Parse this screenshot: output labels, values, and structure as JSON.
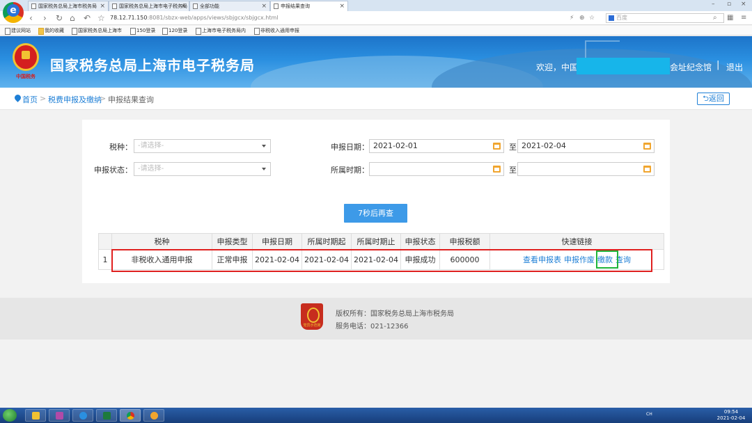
{
  "browser": {
    "tabs": [
      {
        "title": "国家税务总局上海市税务局"
      },
      {
        "title": "国家税务总局上海市电子税务局"
      },
      {
        "title": "全部功能"
      },
      {
        "title": "申报结果查询"
      }
    ],
    "url_host": "78.12.71.150",
    "url_path": ":8081/sbzx-web/apps/views/sbjgcx/sbjgcx.html",
    "search_placeholder": "百度",
    "bookmarks": [
      {
        "label": "建议网站"
      },
      {
        "label": "我的收藏"
      },
      {
        "label": "国家税务总局上海市"
      },
      {
        "label": "150登录"
      },
      {
        "label": "120登录"
      },
      {
        "label": "上海市电子税务局内"
      },
      {
        "label": "非税收入通用申报"
      }
    ]
  },
  "header": {
    "emblem_text": "中国税务",
    "site_title": "国家税务总局上海市电子税务局",
    "welcome": "欢迎，中国",
    "memorial": "会址纪念馆",
    "separator": "|",
    "logout": "退出"
  },
  "breadcrumb": {
    "home": "首页",
    "level1": "税费申报及缴纳",
    "current": "申报结果查询",
    "arrow": ">",
    "back": "返回"
  },
  "form": {
    "tax_type_label": "税种：",
    "tax_type_placeholder": "-请选择-",
    "status_label": "申报状态：",
    "status_placeholder": "-请选择-",
    "date_label": "申报日期：",
    "date_from": "2021-02-01",
    "date_to": "2021-02-04",
    "period_label": "所属时期：",
    "period_from": "",
    "period_to": "",
    "to_label": "至",
    "query_button": "7秒后再查"
  },
  "table": {
    "headers": [
      "",
      "税种",
      "申报类型",
      "申报日期",
      "所属时期起",
      "所属时期止",
      "申报状态",
      "申报税额",
      "快速链接"
    ],
    "rows": [
      {
        "index": "1",
        "tax_type": "非税收入通用申报",
        "declare_type": "正常申报",
        "declare_date": "2021-02-04",
        "period_start": "2021-02-04",
        "period_end": "2021-02-04",
        "status": "申报成功",
        "amount": "600000",
        "links": [
          "查看申报表",
          "申报作废",
          "缴款",
          "查询"
        ]
      }
    ]
  },
  "footer": {
    "badge_text": "党员示范岗",
    "copyright": "版权所有：国家税务总局上海市税务局",
    "phone": "服务电话：021-12366"
  },
  "taskbar": {
    "tray_text": "CH",
    "time": "09:54",
    "date": "2021-02-04"
  },
  "colors": {
    "link": "#1e7fd6",
    "button": "#3d9ae8",
    "highlight_red": "#e0201f",
    "highlight_green": "#1fb53a"
  }
}
